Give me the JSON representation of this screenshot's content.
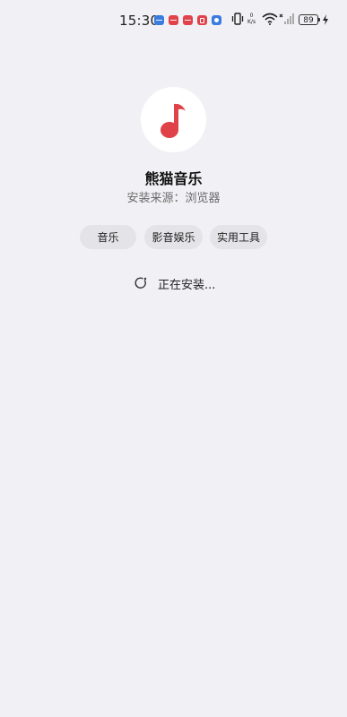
{
  "status_bar": {
    "time": "15:30",
    "net_speed_value": "0",
    "net_speed_unit": "K/s",
    "battery": "89"
  },
  "app": {
    "name": "熊猫音乐",
    "source": "安装来源：浏览器",
    "icon": "music-note-icon",
    "accent_color": "#e0424a"
  },
  "tags": [
    "音乐",
    "影音娱乐",
    "实用工具"
  ],
  "status": {
    "text": "正在安装..."
  }
}
